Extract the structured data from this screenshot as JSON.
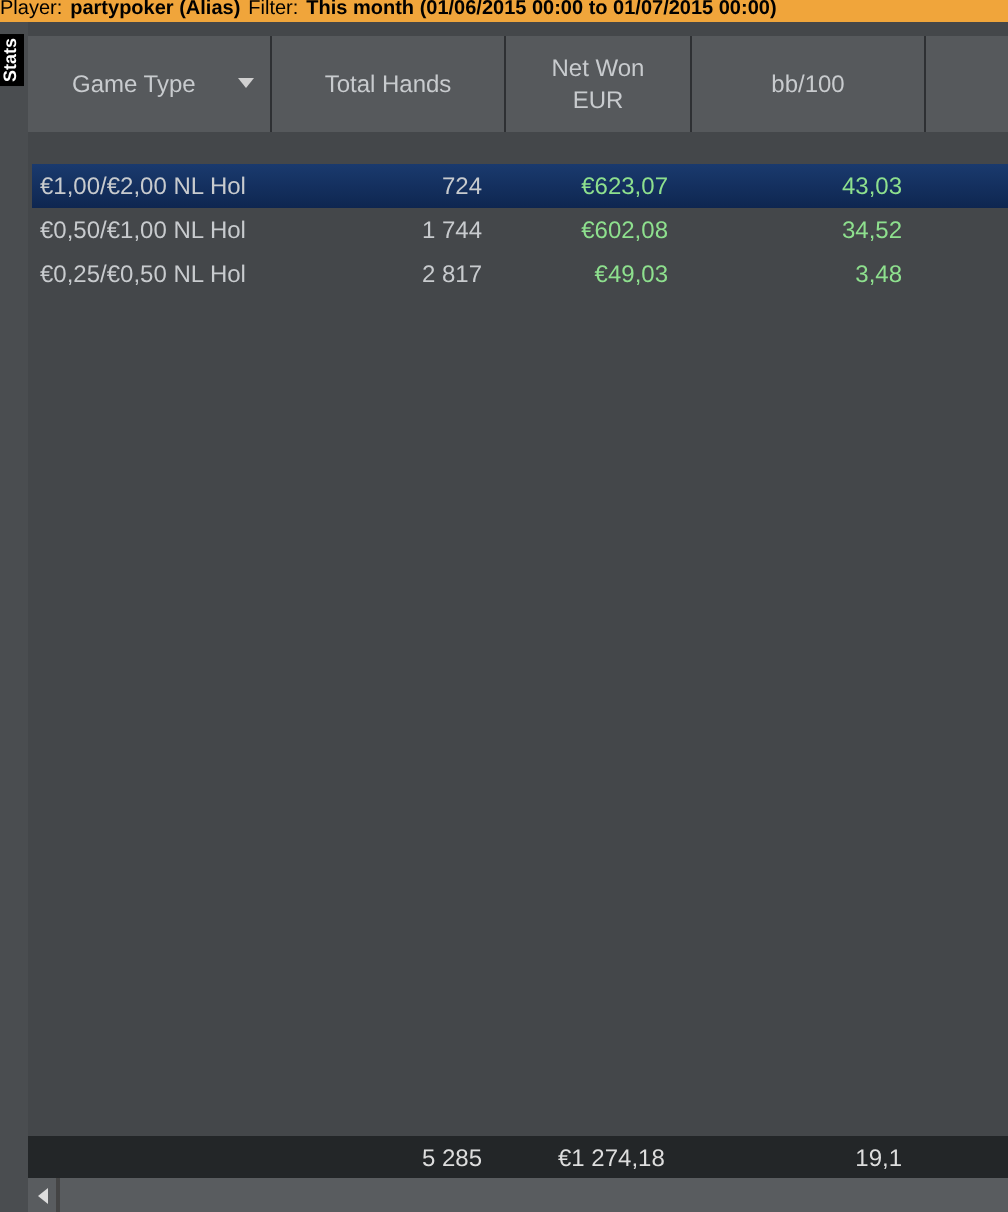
{
  "filter_bar": {
    "player_label": "Player:",
    "player": "partypoker (Alias)",
    "filter_label": "Filter:",
    "filter": "This month (01/06/2015 00:00 to 01/07/2015 00:00)"
  },
  "side_tab": {
    "label": "Stats",
    "selected": true
  },
  "table": {
    "columns": [
      {
        "label": "Game Type",
        "sortable": true
      },
      {
        "label": "Total Hands",
        "sortable": false
      },
      {
        "label": "Net Won EUR",
        "sortable": false
      },
      {
        "label": "bb/100",
        "sortable": false
      }
    ],
    "rows": [
      {
        "game_type": "€1,00/€2,00 NL Hol",
        "total_hands": "724",
        "net_won": "€623,07",
        "bb_100": "43,03",
        "selected": true
      },
      {
        "game_type": "€0,50/€1,00 NL Hol",
        "total_hands": "1 744",
        "net_won": "€602,08",
        "bb_100": "34,52",
        "selected": false
      },
      {
        "game_type": "€0,25/€0,50 NL Hol",
        "total_hands": "2 817",
        "net_won": "€49,03",
        "bb_100": "3,48",
        "selected": false
      }
    ],
    "totals": {
      "total_hands": "5 285",
      "net_won": "€1 274,18",
      "bb_100": "19,1"
    }
  }
}
